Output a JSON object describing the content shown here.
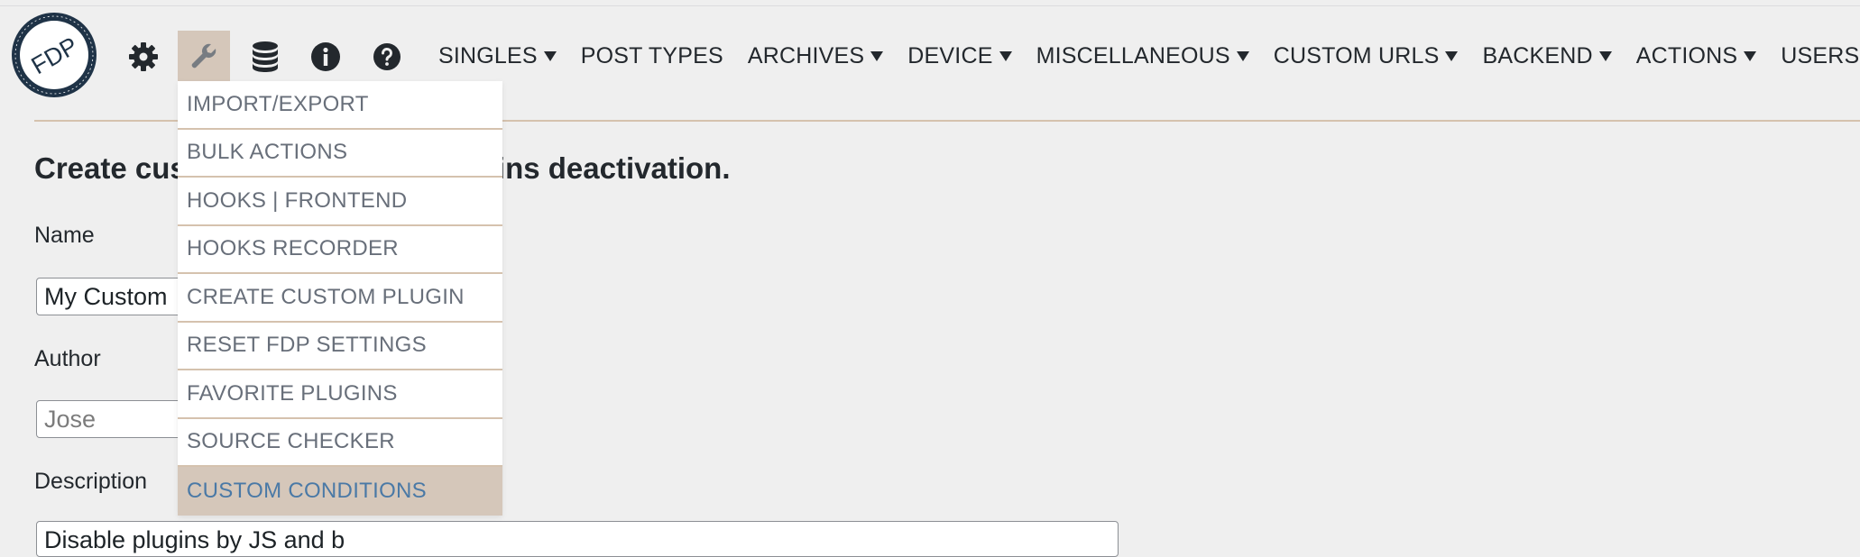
{
  "logo": {
    "text": "FDP",
    "ring_text": "LOAD PLUGINS ONLY WHERE YOU NEED THEM"
  },
  "toolbar": {
    "icons": [
      "gear-icon",
      "wrench-icon",
      "database-icon",
      "info-icon",
      "help-icon"
    ]
  },
  "nav": {
    "items": [
      {
        "label": "SINGLES",
        "has_caret": true
      },
      {
        "label": "POST TYPES",
        "has_caret": false
      },
      {
        "label": "ARCHIVES",
        "has_caret": true
      },
      {
        "label": "DEVICE",
        "has_caret": true
      },
      {
        "label": "MISCELLANEOUS",
        "has_caret": true
      },
      {
        "label": "CUSTOM URLS",
        "has_caret": true
      },
      {
        "label": "BACKEND",
        "has_caret": true
      },
      {
        "label": "ACTIONS",
        "has_caret": true
      },
      {
        "label": "USERS",
        "has_caret": true
      }
    ]
  },
  "dropdown": {
    "items": [
      "IMPORT/EXPORT",
      "BULK ACTIONS",
      "HOOKS | FRONTEND",
      "HOOKS RECORDER",
      "CREATE CUSTOM PLUGIN",
      "RESET FDP SETTINGS",
      "FAVORITE PLUGINS",
      "SOURCE CHECKER",
      "CUSTOM CONDITIONS"
    ],
    "highlighted": "CUSTOM CONDITIONS"
  },
  "form": {
    "heading_left": "Create cus",
    "heading_right": "gins deactivation.",
    "name_label": "Name",
    "name_value": "My Custom",
    "author_label": "Author",
    "author_placeholder": "Jose",
    "description_label": "Description",
    "description_value": "Disable plugins by JS and b"
  },
  "colors": {
    "background": "#efefef",
    "accent": "#d5c7ba",
    "divider": "#d5c2ae",
    "highlight_text": "#4a79a6",
    "logo_navy": "#1f3347"
  }
}
